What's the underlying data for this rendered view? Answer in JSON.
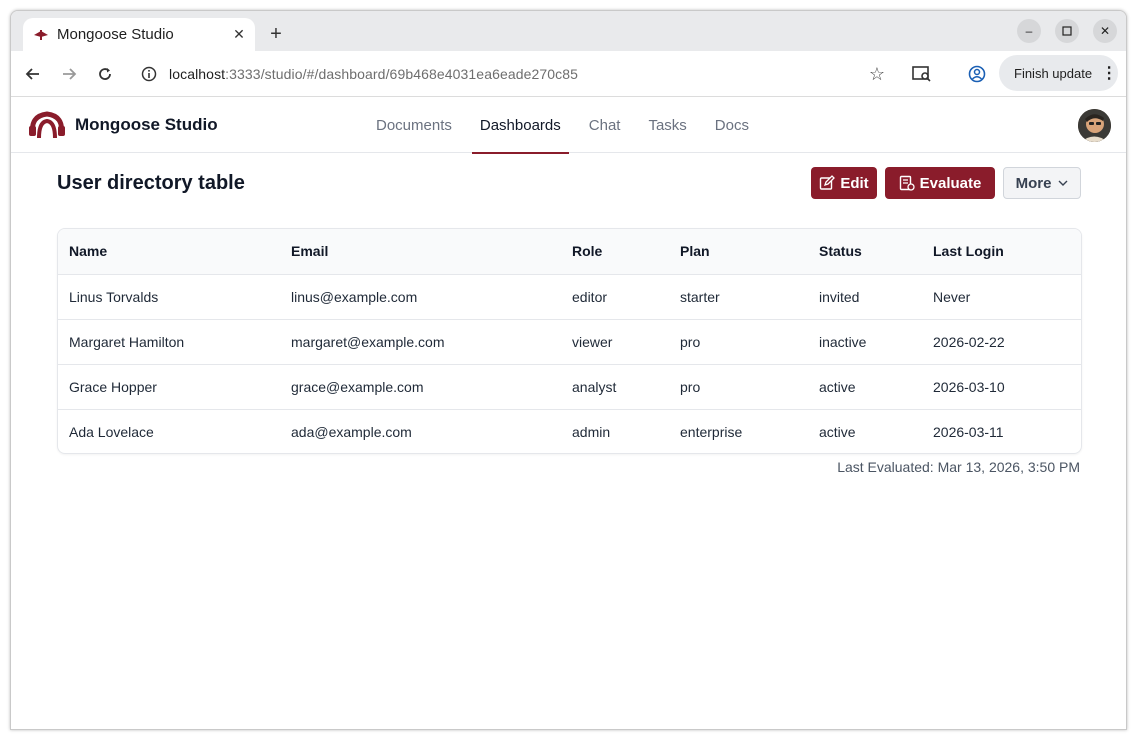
{
  "browser": {
    "tab_title": "Mongoose Studio",
    "url_host": "localhost",
    "url_rest": ":3333/studio/#/dashboard/69b468e4031ea6eade270c85",
    "finish_update_label": "Finish update"
  },
  "app": {
    "brand": "Mongoose Studio",
    "nav": [
      {
        "label": "Documents",
        "active": false
      },
      {
        "label": "Dashboards",
        "active": true
      },
      {
        "label": "Chat",
        "active": false
      },
      {
        "label": "Tasks",
        "active": false
      },
      {
        "label": "Docs",
        "active": false
      }
    ],
    "accent_color": "#8a1c2b"
  },
  "dashboard": {
    "title": "User directory table",
    "buttons": {
      "edit": "Edit",
      "evaluate": "Evaluate",
      "more": "More"
    },
    "table": {
      "columns": [
        "Name",
        "Email",
        "Role",
        "Plan",
        "Status",
        "Last Login"
      ],
      "rows": [
        [
          "Linus Torvalds",
          "linus@example.com",
          "editor",
          "starter",
          "invited",
          "Never"
        ],
        [
          "Margaret Hamilton",
          "margaret@example.com",
          "viewer",
          "pro",
          "inactive",
          "2026-02-22"
        ],
        [
          "Grace Hopper",
          "grace@example.com",
          "analyst",
          "pro",
          "active",
          "2026-03-10"
        ],
        [
          "Ada Lovelace",
          "ada@example.com",
          "admin",
          "enterprise",
          "active",
          "2026-03-11"
        ]
      ]
    },
    "last_evaluated": "Last Evaluated: Mar 13, 2026, 3:50 PM"
  }
}
